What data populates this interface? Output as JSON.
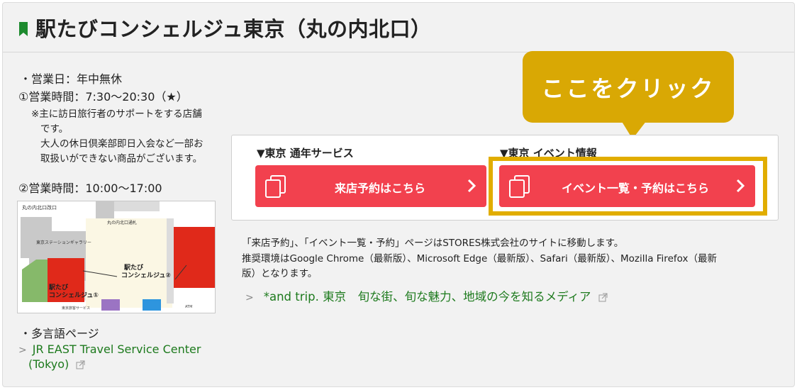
{
  "page": {
    "title": "駅たびコンシェルジュ東京（丸の内北口）",
    "accent_color": "#1d7a1d",
    "button_color": "#f2414e",
    "highlight_color": "#e1ad00"
  },
  "info": {
    "business_days": "・営業日：年中無休",
    "hours1": "①営業時間：7:30〜20:30（★）",
    "note_lines": [
      "※主に訪日旅行者のサポートをする店舗",
      "です。",
      "大人の休日倶楽部即日入会など一部お",
      "取扱いができない商品がございます。"
    ],
    "hours2": "②営業時間：10:00〜17:00"
  },
  "map": {
    "icon": "floor-map-image",
    "labels": {
      "exit": "丸の内北口改口",
      "gallery": "東京ステーションギャラリー",
      "passage": "丸の内北口通札",
      "concierge1_a": "駅たび",
      "concierge1_b": "コンシェルジュ①",
      "concierge2_a": "駅たび",
      "concierge2_b": "コンシェルジュ②",
      "service": "東京旅客サービス",
      "atm": "ATM"
    }
  },
  "multilang": {
    "heading": "・多言語ページ",
    "link_line1": "JR EAST Travel Service Center",
    "link_line2": "(Tokyo)"
  },
  "callout": {
    "text": "ここをクリック"
  },
  "panel": {
    "col1_heading": "▼東京 通年サービス",
    "col1_button": "来店予約はこちら",
    "col2_heading": "▼東京 イベント情報",
    "col2_button": "イベント一覧・予約はこちら"
  },
  "notes": [
    "「来店予約」、「イベント一覧・予約」ページはSTORES株式会社のサイトに移動します。",
    "推奨環境はGoogle Chrome（最新版）、Microsoft Edge（最新版）、Safari（最新版）、Mozilla Firefox（最新",
    "版）となります。"
  ],
  "andtrip": {
    "text": "*and trip. 東京　旬な街、旬な魅力、地域の今を知るメディア"
  }
}
